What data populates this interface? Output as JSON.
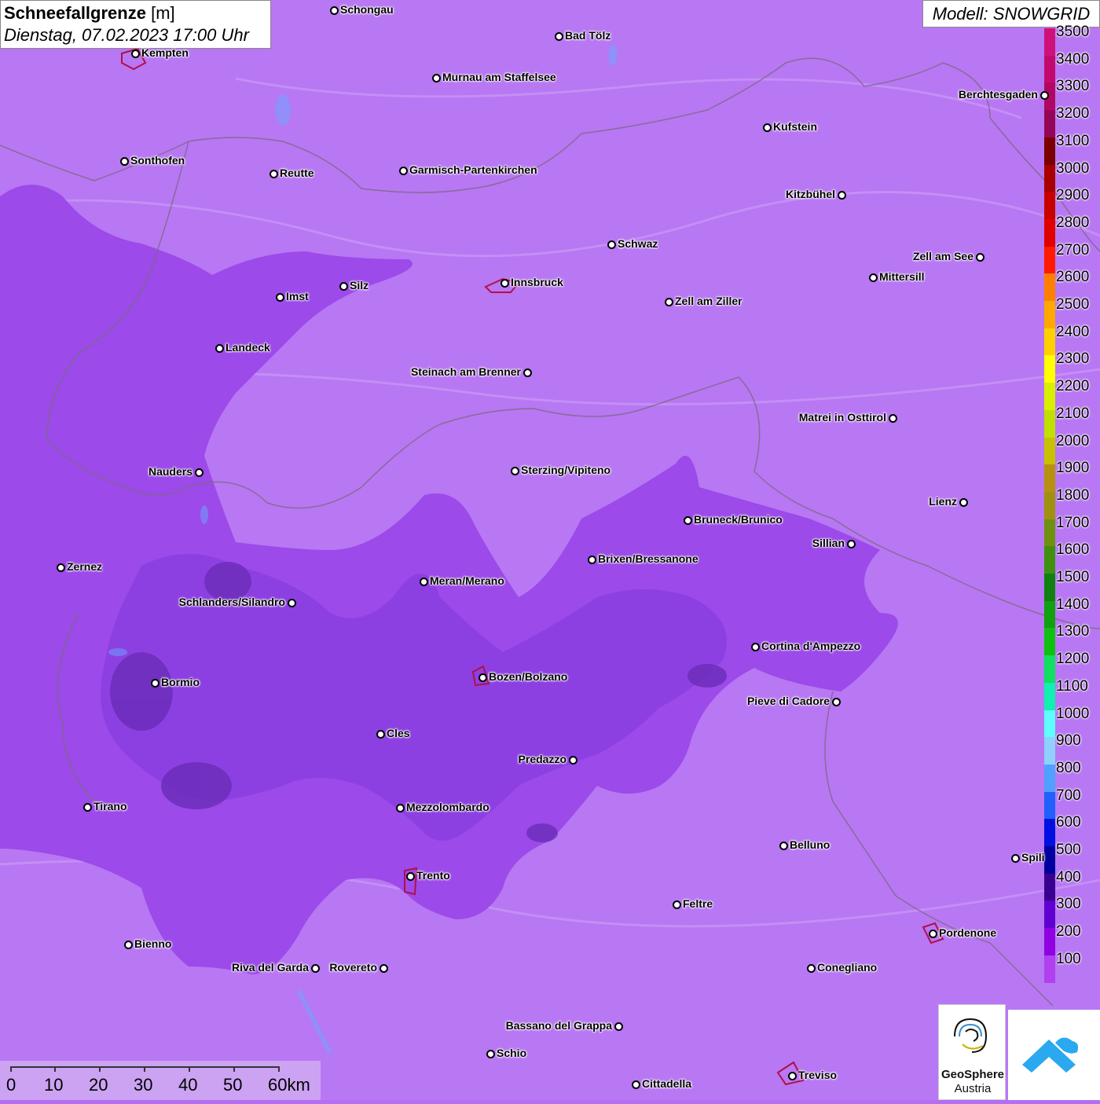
{
  "title": {
    "parameter": "Schneefallgrenze",
    "unit": "[m]",
    "datetime": "Dienstag, 07.02.2023 17:00 Uhr"
  },
  "model": "Modell: SNOWGRID",
  "legend": {
    "labels": [
      "3500",
      "3400",
      "3300",
      "3200",
      "3100",
      "3000",
      "2900",
      "2800",
      "2700",
      "2600",
      "2500",
      "2400",
      "2300",
      "2200",
      "2100",
      "2000",
      "1900",
      "1800",
      "1700",
      "1600",
      "1500",
      "1400",
      "1300",
      "1200",
      "1100",
      "1000",
      "900",
      "800",
      "700",
      "600",
      "500",
      "400",
      "300",
      "200",
      "100"
    ],
    "colors": [
      "#d0107a",
      "#c20a6e",
      "#b00862",
      "#960656",
      "#7a0000",
      "#a80000",
      "#c80000",
      "#e00000",
      "#ff1a00",
      "#ff8000",
      "#ffa800",
      "#ffd000",
      "#ffff00",
      "#d8f000",
      "#c0e000",
      "#c8c000",
      "#b89010",
      "#a09010",
      "#709010",
      "#409010",
      "#108010",
      "#10a010",
      "#10c010",
      "#10e060",
      "#10f0b0",
      "#60ffff",
      "#90d0ff",
      "#50a0ff",
      "#2060ff",
      "#0010e0",
      "#0000a0",
      "#3a0090",
      "#6000d0",
      "#9000e0",
      "#b040f0"
    ]
  },
  "cities": [
    {
      "name": "Schongau"
    },
    {
      "name": "Bad Tölz"
    },
    {
      "name": "Kempten"
    },
    {
      "name": "Murnau am Staffelsee"
    },
    {
      "name": "Berchtesgaden"
    },
    {
      "name": "Kufstein"
    },
    {
      "name": "Sonthofen"
    },
    {
      "name": "Reutte"
    },
    {
      "name": "Garmisch-Partenkirchen"
    },
    {
      "name": "Kitzbühel"
    },
    {
      "name": "Schwaz"
    },
    {
      "name": "Zell am See"
    },
    {
      "name": "Silz"
    },
    {
      "name": "Innsbruck"
    },
    {
      "name": "Imst"
    },
    {
      "name": "Mittersill"
    },
    {
      "name": "Zell am Ziller"
    },
    {
      "name": "Landeck"
    },
    {
      "name": "Steinach am Brenner"
    },
    {
      "name": "Matrei in Osttirol"
    },
    {
      "name": "Nauders"
    },
    {
      "name": "Sterzing/Vipiteno"
    },
    {
      "name": "Lienz"
    },
    {
      "name": "Bruneck/Brunico"
    },
    {
      "name": "Sillian"
    },
    {
      "name": "Zernez"
    },
    {
      "name": "Brixen/Bressanone"
    },
    {
      "name": "Meran/Merano"
    },
    {
      "name": "Schlanders/Silandro"
    },
    {
      "name": "Cortina d'Ampezzo"
    },
    {
      "name": "Bozen/Bolzano"
    },
    {
      "name": "Bormio"
    },
    {
      "name": "Pieve di Cadore"
    },
    {
      "name": "Cles"
    },
    {
      "name": "Predazzo"
    },
    {
      "name": "Tirano"
    },
    {
      "name": "Mezzolombardo"
    },
    {
      "name": "Belluno"
    },
    {
      "name": "Spili"
    },
    {
      "name": "Trento"
    },
    {
      "name": "Feltre"
    },
    {
      "name": "Pordenone"
    },
    {
      "name": "Bienno"
    },
    {
      "name": "Riva del Garda"
    },
    {
      "name": "Rovereto"
    },
    {
      "name": "Conegliano"
    },
    {
      "name": "Bassano del Grappa"
    },
    {
      "name": "Schio"
    },
    {
      "name": "Treviso"
    },
    {
      "name": "Cittadella"
    }
  ],
  "scale": {
    "labels": [
      "0",
      "10",
      "20",
      "30",
      "40",
      "50",
      "60km"
    ]
  },
  "logos": {
    "geosphere_line1": "GeoSphere",
    "geosphere_line2": "Austria"
  }
}
